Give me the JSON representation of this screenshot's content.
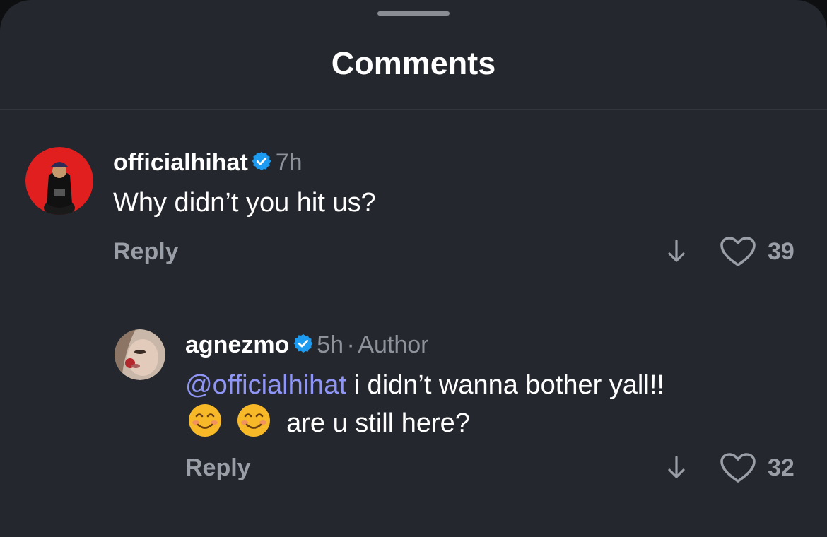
{
  "header": {
    "title": "Comments"
  },
  "comments": [
    {
      "username": "officialhihat",
      "time": "7h",
      "text": "Why didn’t you hit us?",
      "reply_label": "Reply",
      "likes": "39"
    }
  ],
  "reply": {
    "username": "agnezmo",
    "time": "5h",
    "separator": "·",
    "author_label": "Author",
    "mention": "@officialhihat",
    "text_line1": " i didn’t wanna bother yall!!",
    "text_line2": "are u still here?",
    "reply_label": "Reply",
    "likes": "32"
  },
  "colors": {
    "background": "#24272d",
    "verified": "#1d9bf0",
    "mention": "#8e95f5",
    "muted": "#9a9ea6"
  }
}
